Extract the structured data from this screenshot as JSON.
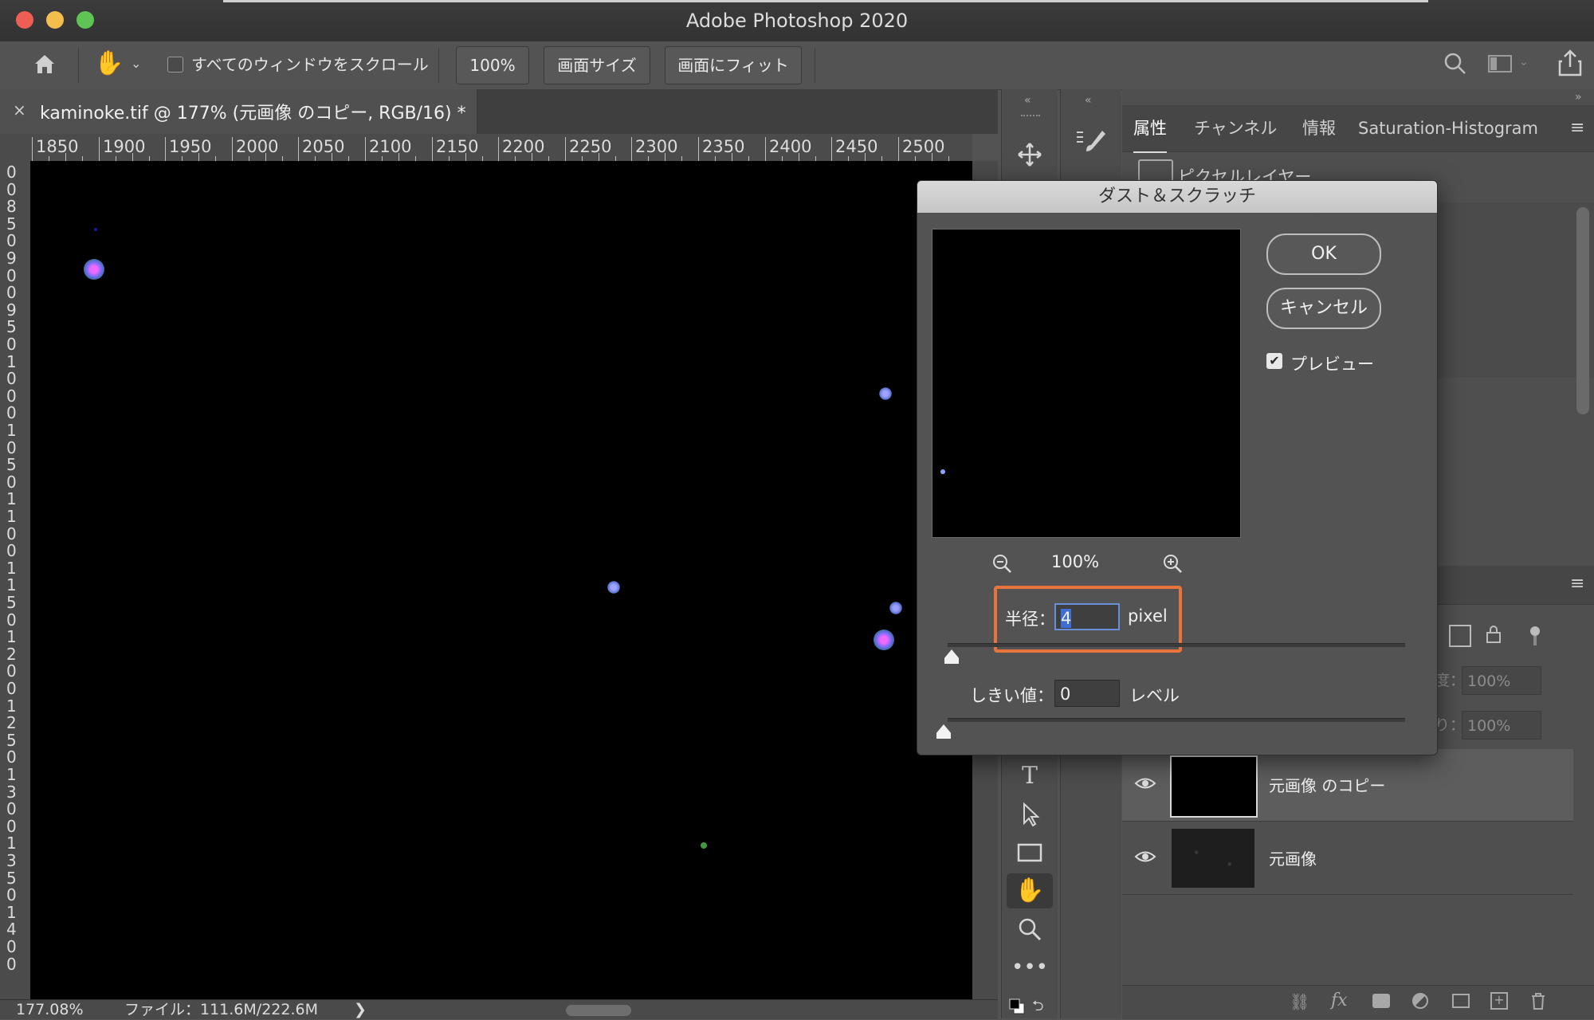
{
  "window": {
    "title": "Adobe Photoshop 2020"
  },
  "options_bar": {
    "scroll_all_label": "すべてのウィンドウをスクロール",
    "zoom_btn": "100%",
    "fit_screen_btn": "画面サイズ",
    "fill_screen_btn": "画面にフィット"
  },
  "document": {
    "tab_title": "kaminoke.tif @ 177% (元画像 のコピー, RGB/16) *"
  },
  "ruler": {
    "h_labels": [
      "1850",
      "1900",
      "1950",
      "2000",
      "2050",
      "2100",
      "2150",
      "2200",
      "2250",
      "2300",
      "2350",
      "2400",
      "2450",
      "2500"
    ],
    "v_labels": [
      "0",
      "0",
      "8",
      "5",
      "0",
      "9",
      "0",
      "0",
      "9",
      "5",
      "0",
      "1",
      "0",
      "0",
      "0",
      "1",
      "0",
      "5",
      "0",
      "1",
      "1",
      "0",
      "0",
      "1",
      "1",
      "5",
      "0",
      "1",
      "2",
      "0",
      "0",
      "1",
      "2",
      "5",
      "0",
      "1",
      "3",
      "0",
      "0",
      "1",
      "3",
      "5",
      "0",
      "1",
      "4",
      "0",
      "0"
    ]
  },
  "status": {
    "zoom": "177.08%",
    "file": "ファイル：111.6M/222.6M",
    "arrow": "❯"
  },
  "panel_tabs": [
    "属性",
    "チャンネル",
    "情報",
    "Saturation-Histogram"
  ],
  "properties": {
    "pixel_layer": "ピクセルレイヤー"
  },
  "layers": {
    "opacity_value": "100%",
    "fill_value": "100%",
    "opacity_tail": "度：",
    "fill_tail": "り：",
    "items": [
      {
        "name": "元画像 のコピー"
      },
      {
        "name": "元画像"
      }
    ]
  },
  "dialog": {
    "title": "ダスト＆スクラッチ",
    "ok": "OK",
    "cancel": "キャンセル",
    "preview_label": "プレビュー",
    "zoom": "100%",
    "radius_label": "半径：",
    "radius_value": "4",
    "radius_unit": "pixel",
    "threshold_label": "しきい値：",
    "threshold_value": "0",
    "threshold_unit": "レベル"
  },
  "colors": {
    "highlight": "#e8743b",
    "canvas": "#000000",
    "panel": "#535353"
  }
}
